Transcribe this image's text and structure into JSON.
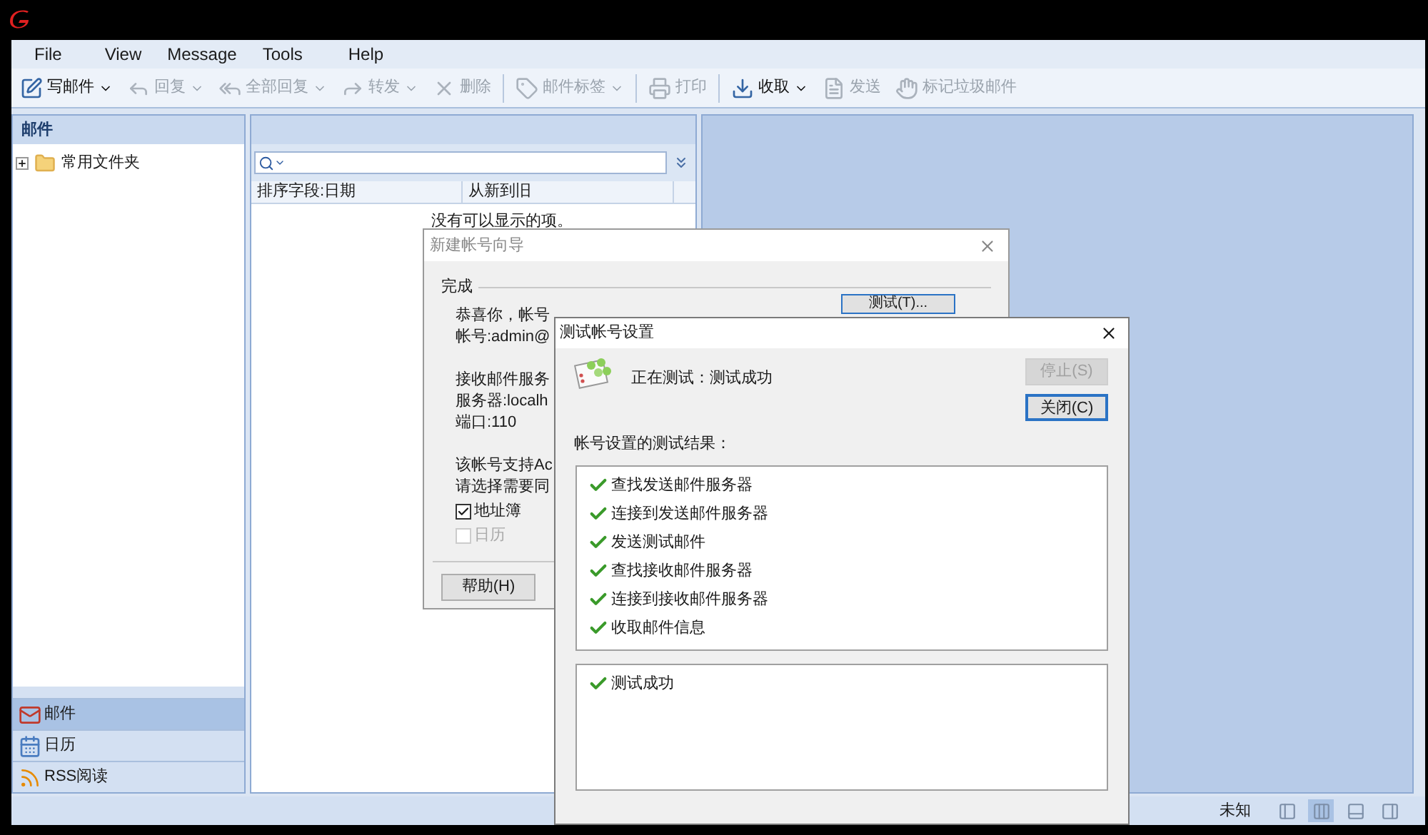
{
  "menu": [
    "File",
    "View",
    "Message",
    "Tools",
    "Help"
  ],
  "toolbar": [
    {
      "label": "写邮件",
      "dropdown": true,
      "disabled": false
    },
    {
      "label": "回复",
      "dropdown": true,
      "disabled": true
    },
    {
      "label": "全部回复",
      "dropdown": true,
      "disabled": true
    },
    {
      "label": "转发",
      "dropdown": true,
      "disabled": true
    },
    {
      "label": "删除",
      "dropdown": false,
      "disabled": true
    },
    {
      "label": "邮件标签",
      "dropdown": true,
      "disabled": true
    },
    {
      "label": "打印",
      "dropdown": false,
      "disabled": true
    },
    {
      "label": "收取",
      "dropdown": true,
      "disabled": false
    },
    {
      "label": "发送",
      "dropdown": false,
      "disabled": true
    },
    {
      "label": "标记垃圾邮件",
      "dropdown": false,
      "disabled": true
    }
  ],
  "folders": {
    "title": "邮件",
    "tree": [
      {
        "label": "常用文件夹",
        "expanded": false
      }
    ]
  },
  "nav": [
    {
      "label": "邮件",
      "selected": true
    },
    {
      "label": "日历",
      "selected": false
    },
    {
      "label": "RSS阅读",
      "selected": false
    }
  ],
  "message_list": {
    "columns": [
      "排序字段:日期",
      "从新到旧"
    ],
    "empty": "没有可以显示的项。"
  },
  "status_bar": {
    "text": "未知",
    "views": [
      {
        "selected": false
      },
      {
        "selected": true
      },
      {
        "selected": false
      },
      {
        "selected": false
      }
    ]
  },
  "wizard": {
    "title": "新建帐号向导",
    "heading": "完成",
    "test_button": "测试(T)...",
    "paragraphs": [
      [
        "恭喜你，帐号",
        "帐号:admin@"
      ],
      [
        "接收邮件服务",
        "服务器:localh",
        "端口:110"
      ],
      [
        "该帐号支持Ac",
        "请选择需要同"
      ]
    ],
    "sync": [
      {
        "label": "地址簿",
        "checked": true,
        "disabled": false
      },
      {
        "label": "日历",
        "checked": false,
        "disabled": true
      }
    ],
    "help_button": "帮助(H)"
  },
  "test_dialog": {
    "title": "测试帐号设置",
    "status": "正在测试：测试成功",
    "stop_button": {
      "label": "停止(S)",
      "disabled": true
    },
    "close_button": {
      "label": "关闭(C)",
      "disabled": false
    },
    "results_label": "帐号设置的测试结果：",
    "results": [
      {
        "label": "查找发送邮件服务器",
        "ok": true
      },
      {
        "label": "连接到发送邮件服务器",
        "ok": true
      },
      {
        "label": "发送测试邮件",
        "ok": true
      },
      {
        "label": "查找接收邮件服务器",
        "ok": true
      },
      {
        "label": "连接到接收邮件服务器",
        "ok": true
      },
      {
        "label": "收取邮件信息",
        "ok": true
      }
    ],
    "summary": [
      {
        "label": "测试成功",
        "ok": true
      }
    ]
  }
}
